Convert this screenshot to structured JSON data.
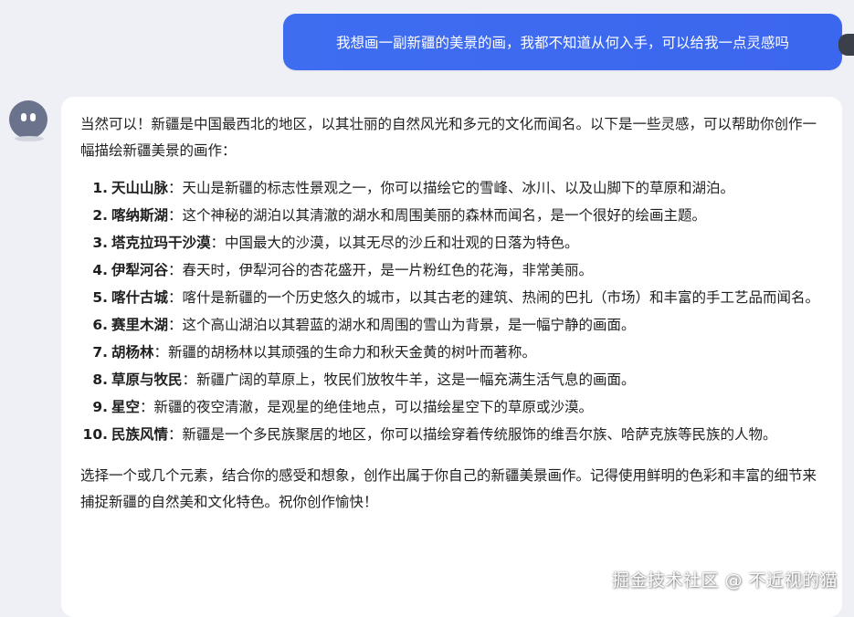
{
  "user_message": "我想画一副新疆的美景的画，我都不知道从何入手，可以给我一点灵感吗",
  "bot": {
    "intro": "当然可以！新疆是中国最西北的地区，以其壮丽的自然风光和多元的文化而闻名。以下是一些灵感，可以帮助你创作一幅描绘新疆美景的画作：",
    "items": [
      {
        "num": "1.",
        "title": "天山山脉",
        "text": "：天山是新疆的标志性景观之一，你可以描绘它的雪峰、冰川、以及山脚下的草原和湖泊。"
      },
      {
        "num": "2.",
        "title": "喀纳斯湖",
        "text": "：这个神秘的湖泊以其清澈的湖水和周围美丽的森林而闻名，是一个很好的绘画主题。"
      },
      {
        "num": "3.",
        "title": "塔克拉玛干沙漠",
        "text": "：中国最大的沙漠，以其无尽的沙丘和壮观的日落为特色。"
      },
      {
        "num": "4.",
        "title": "伊犁河谷",
        "text": "：春天时，伊犁河谷的杏花盛开，是一片粉红色的花海，非常美丽。"
      },
      {
        "num": "5.",
        "title": "喀什古城",
        "text": "：喀什是新疆的一个历史悠久的城市，以其古老的建筑、热闹的巴扎（市场）和丰富的手工艺品而闻名。"
      },
      {
        "num": "6.",
        "title": "赛里木湖",
        "text": "：这个高山湖泊以其碧蓝的湖水和周围的雪山为背景，是一幅宁静的画面。"
      },
      {
        "num": "7.",
        "title": "胡杨林",
        "text": "：新疆的胡杨林以其顽强的生命力和秋天金黄的树叶而著称。"
      },
      {
        "num": "8.",
        "title": "草原与牧民",
        "text": "：新疆广阔的草原上，牧民们放牧牛羊，这是一幅充满生活气息的画面。"
      },
      {
        "num": "9.",
        "title": "星空",
        "text": "：新疆的夜空清澈，是观星的绝佳地点，可以描绘星空下的草原或沙漠。"
      },
      {
        "num": "10.",
        "title": "民族风情",
        "text": "：新疆是一个多民族聚居的地区，你可以描绘穿着传统服饰的维吾尔族、哈萨克族等民族的人物。"
      }
    ],
    "outro": "选择一个或几个元素，结合你的感受和想象，创作出属于你自己的新疆美景画作。记得使用鲜明的色彩和丰富的细节来捕捉新疆的自然美和文化特色。祝你创作愉快！"
  },
  "watermark": "掘金技术社区 @ 不近视的猫",
  "colors": {
    "user_bubble": "#3f6df0",
    "background": "#eef0f5",
    "card": "#ffffff",
    "bot_avatar": "#6b738c"
  },
  "icons": {
    "bot_avatar": "robot-face-icon"
  }
}
